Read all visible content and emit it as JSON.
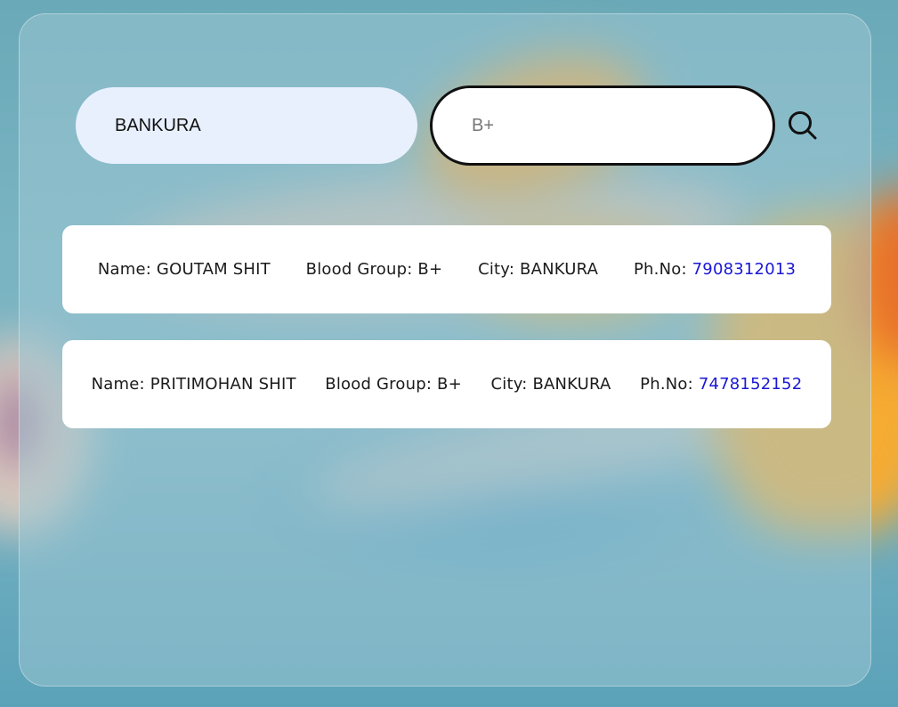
{
  "search": {
    "city_value": "BANKURA",
    "blood_group_placeholder": "B+",
    "search_icon": "search-icon"
  },
  "results": [
    {
      "name_label": "Name:",
      "name": "GOUTAM SHIT",
      "group_label": "Blood Group:",
      "group": "B+",
      "city_label": "City:",
      "city": "BANKURA",
      "phone_label": "Ph.No:",
      "phone": "7908312013"
    },
    {
      "name_label": "Name:",
      "name": "PRITIMOHAN SHIT",
      "group_label": "Blood Group:",
      "group": "B+",
      "city_label": "City:",
      "city": "BANKURA",
      "phone_label": "Ph.No:",
      "phone": "7478152152"
    }
  ],
  "colors": {
    "link": "#1a17d6",
    "city_input_bg": "#e8f0fe",
    "card_bg": "#ffffff"
  }
}
